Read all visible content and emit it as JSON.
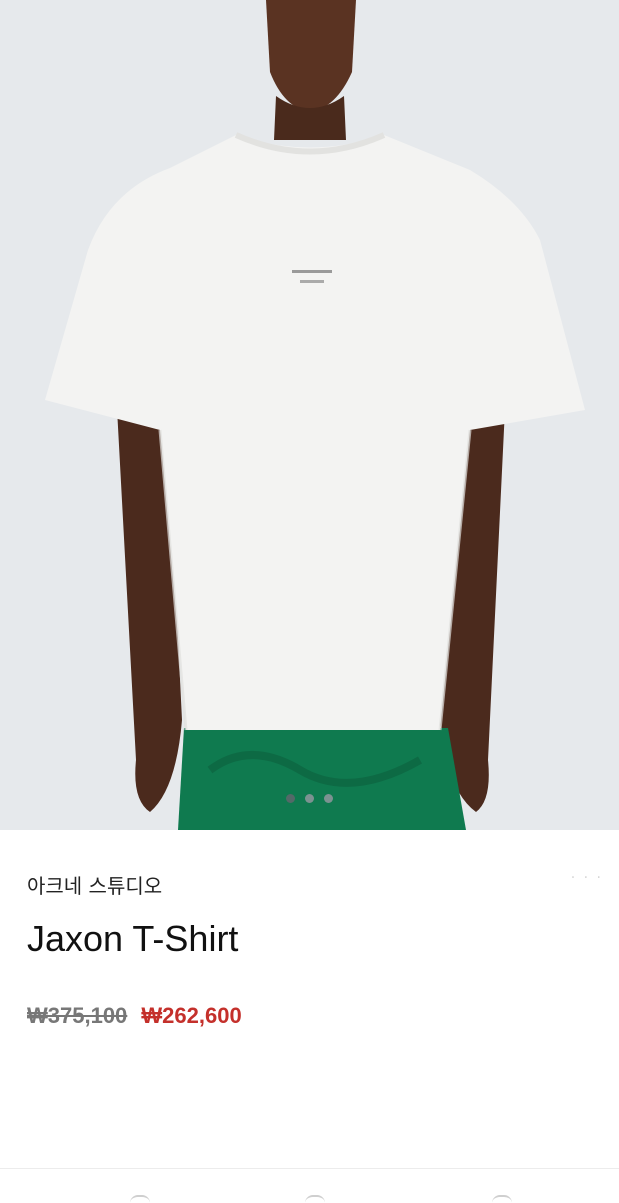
{
  "product": {
    "brand": "아크네 스튜디오",
    "name": "Jaxon T-Shirt",
    "original_price": "₩375,100",
    "sale_price": "₩262,600",
    "image_dots": 3,
    "active_dot": 1
  },
  "colors": {
    "accent_price": "#c4302b",
    "shirt": "#f3f3f2",
    "shorts": "#0f7a4f"
  },
  "icons": [
    "image-dot",
    "bottom-nav-icon"
  ]
}
